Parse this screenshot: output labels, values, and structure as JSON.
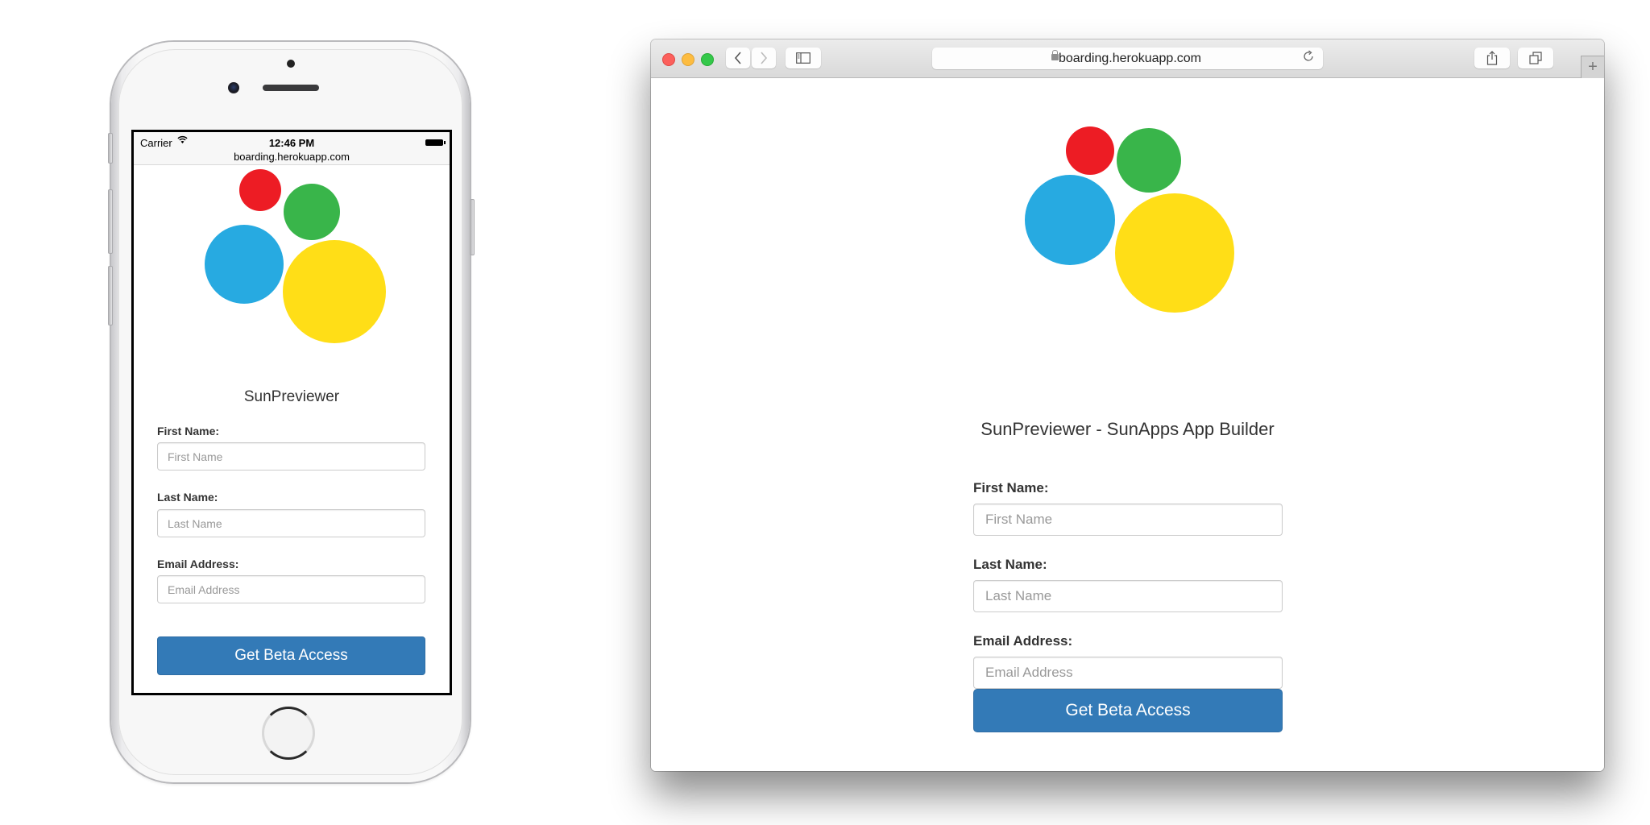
{
  "colors": {
    "logo_red": "#ed1c24",
    "logo_green": "#39b54a",
    "logo_blue": "#27aae1",
    "logo_yellow": "#ffde17",
    "button_primary": "#337ab7",
    "close": "#fc605c",
    "minimize": "#fdbc40",
    "zoom": "#34c84a"
  },
  "mobile": {
    "status_bar": {
      "carrier": "Carrier",
      "wifi_icon": "wifi-icon",
      "time": "12:46 PM",
      "battery_icon": "battery-full-icon",
      "url": "boarding.herokuapp.com"
    },
    "page": {
      "logo_icon": "sunapps-circles-logo",
      "title": "SunPreviewer",
      "form": {
        "first_name": {
          "label": "First Name:",
          "placeholder": "First Name",
          "value": ""
        },
        "last_name": {
          "label": "Last Name:",
          "placeholder": "Last Name",
          "value": ""
        },
        "email": {
          "label": "Email Address:",
          "placeholder": "Email Address",
          "value": ""
        },
        "submit_label": "Get Beta Access"
      }
    }
  },
  "desktop": {
    "toolbar": {
      "back_icon": "chevron-left-icon",
      "forward_icon": "chevron-right-icon",
      "sidebar_icon": "sidebar-icon",
      "address": "boarding.herokuapp.com",
      "lock_icon": "lock-icon",
      "reload_icon": "reload-icon",
      "share_icon": "share-icon",
      "tabs_icon": "tabs-overview-icon",
      "new_tab_label": "+"
    },
    "page": {
      "logo_icon": "sunapps-circles-logo",
      "title": "SunPreviewer - SunApps App Builder",
      "form": {
        "first_name": {
          "label": "First Name:",
          "placeholder": "First Name",
          "value": ""
        },
        "last_name": {
          "label": "Last Name:",
          "placeholder": "Last Name",
          "value": ""
        },
        "email": {
          "label": "Email Address:",
          "placeholder": "Email Address",
          "value": ""
        },
        "submit_label": "Get Beta Access"
      }
    }
  }
}
